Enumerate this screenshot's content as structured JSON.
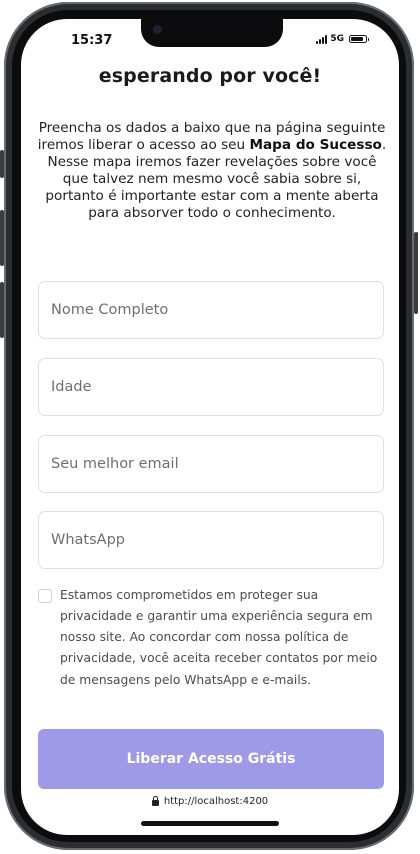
{
  "status_bar": {
    "time": "15:37",
    "network": "5G"
  },
  "page": {
    "headline": "esperando por você!",
    "intro_before": "Preencha os dados a baixo que na página seguinte iremos liberar o acesso ao seu ",
    "intro_bold": "Mapa do Sucesso",
    "intro_after": ". Nesse mapa iremos fazer revelações sobre você que talvez nem mesmo você sabia sobre si, portanto é importante estar com a mente aberta para absorver todo o conhecimento."
  },
  "form": {
    "name_placeholder": "Nome Completo",
    "age_placeholder": "Idade",
    "email_placeholder": "Seu melhor email",
    "whatsapp_placeholder": "WhatsApp",
    "consent_checked": false,
    "consent_text": "Estamos comprometidos em proteger sua privacidade e garantir uma experiência segura em nosso site. Ao concordar com nossa política de privacidade, você aceita receber contatos por meio de mensagens pelo WhatsApp e e-mails.",
    "submit_label": "Liberar Acesso Grátis"
  },
  "browser": {
    "url": "http://localhost:4200"
  },
  "colors": {
    "button_bg": "#9f9ae8",
    "field_border": "#dedfe4"
  }
}
